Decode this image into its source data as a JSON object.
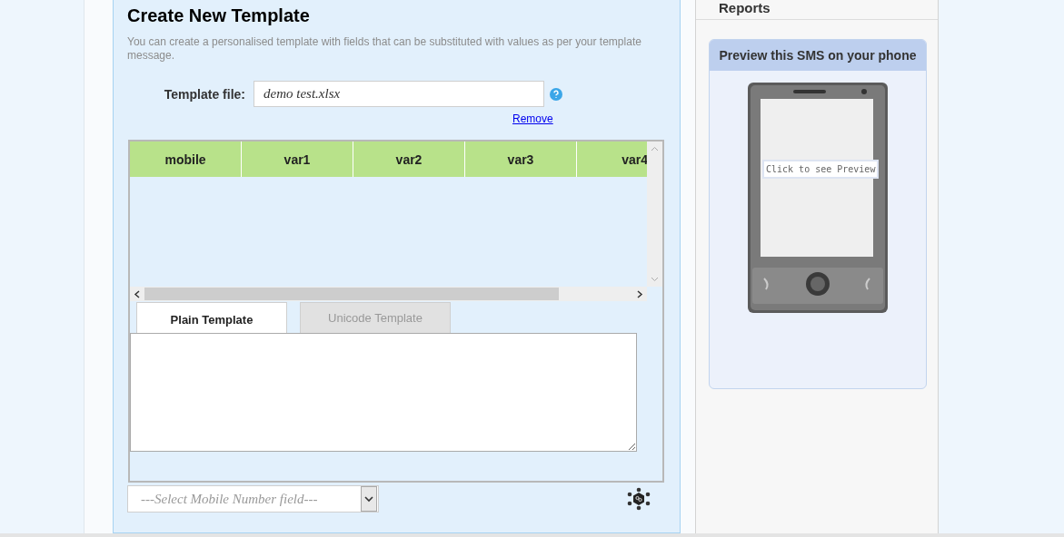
{
  "title": "Create New Template",
  "description": "You can create a personalised template with fields that can be substituted with values as per your template message.",
  "template_file": {
    "label": "Template file:",
    "value": "demo test.xlsx"
  },
  "remove_link": "Remove",
  "table": {
    "columns": [
      "mobile",
      "var1",
      "var2",
      "var3",
      "var4"
    ]
  },
  "tabs": [
    {
      "label": "Plain Template",
      "selected": true
    },
    {
      "label": "Unicode Template",
      "selected": false
    }
  ],
  "mobile_field": {
    "placeholder": "---Select Mobile Number field---"
  },
  "sidebar": {
    "reports": "Reports",
    "preview": {
      "title": "Preview this SMS on your phone",
      "button": "Click to see Preview"
    }
  }
}
